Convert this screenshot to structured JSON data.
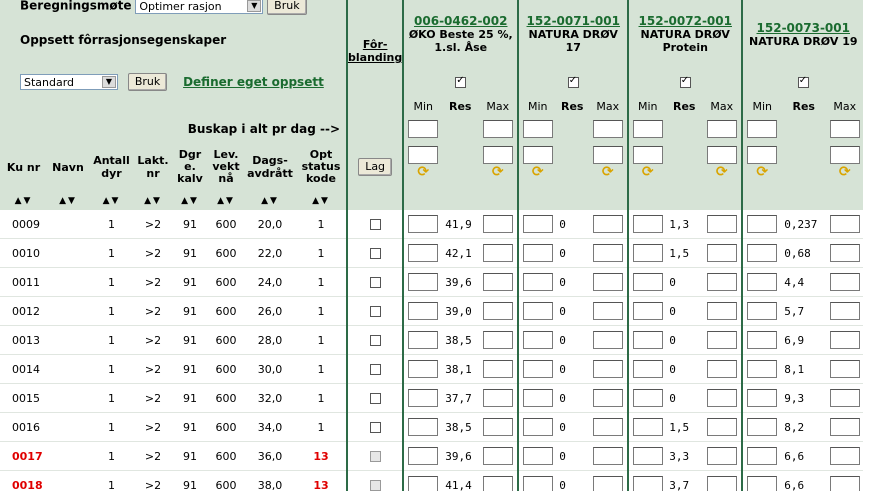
{
  "top": {
    "beregningsmote_label": "Beregningsmøte",
    "beregningsmote_value": "Optimer rasjon",
    "bruk_label": "Bruk",
    "oppsett_title": "Oppsett fôrrasjonsegenskaper",
    "oppsett_value": "Standard",
    "definer_link": "Definer eget oppsett"
  },
  "forblanding_header": "Fôr-blanding",
  "lag_label": "Lag",
  "buskap_label": "Buskap i alt pr dag -->",
  "products": [
    {
      "code": "006-0462-002",
      "name": "ØKO Beste 25 %, 1.sl. Åse",
      "checked": true
    },
    {
      "code": "152-0071-001",
      "name": "NATURA DRØV 17",
      "checked": true
    },
    {
      "code": "152-0072-001",
      "name": "NATURA DRØV Protein",
      "checked": true
    },
    {
      "code": "152-0073-001",
      "name": "NATURA DRØV 19",
      "checked": true
    }
  ],
  "subcols": {
    "min": "Min",
    "res": "Res",
    "max": "Max"
  },
  "columns": {
    "kunr": "Ku nr",
    "navn": "Navn",
    "antall": "Antall dyr",
    "lakt": "Lakt. nr",
    "dgr": "Dgr e. kalv",
    "lev": "Lev. vekt nå",
    "dags": "Dags-avdrått",
    "opt": "Opt status kode"
  },
  "sort_glyph": "▲▼",
  "rows": [
    {
      "kunr": "0009",
      "antall": "1",
      "lakt": ">2",
      "dgr": "91",
      "lev": "600",
      "dags": "20,0",
      "opt": "1",
      "red": false,
      "res": [
        "41,9",
        "0",
        "1,3",
        "0,237"
      ]
    },
    {
      "kunr": "0010",
      "antall": "1",
      "lakt": ">2",
      "dgr": "91",
      "lev": "600",
      "dags": "22,0",
      "opt": "1",
      "red": false,
      "res": [
        "42,1",
        "0",
        "1,5",
        "0,68"
      ]
    },
    {
      "kunr": "0011",
      "antall": "1",
      "lakt": ">2",
      "dgr": "91",
      "lev": "600",
      "dags": "24,0",
      "opt": "1",
      "red": false,
      "res": [
        "39,6",
        "0",
        "0",
        "4,4"
      ]
    },
    {
      "kunr": "0012",
      "antall": "1",
      "lakt": ">2",
      "dgr": "91",
      "lev": "600",
      "dags": "26,0",
      "opt": "1",
      "red": false,
      "res": [
        "39,0",
        "0",
        "0",
        "5,7"
      ]
    },
    {
      "kunr": "0013",
      "antall": "1",
      "lakt": ">2",
      "dgr": "91",
      "lev": "600",
      "dags": "28,0",
      "opt": "1",
      "red": false,
      "res": [
        "38,5",
        "0",
        "0",
        "6,9"
      ]
    },
    {
      "kunr": "0014",
      "antall": "1",
      "lakt": ">2",
      "dgr": "91",
      "lev": "600",
      "dags": "30,0",
      "opt": "1",
      "red": false,
      "res": [
        "38,1",
        "0",
        "0",
        "8,1"
      ]
    },
    {
      "kunr": "0015",
      "antall": "1",
      "lakt": ">2",
      "dgr": "91",
      "lev": "600",
      "dags": "32,0",
      "opt": "1",
      "red": false,
      "res": [
        "37,7",
        "0",
        "0",
        "9,3"
      ]
    },
    {
      "kunr": "0016",
      "antall": "1",
      "lakt": ">2",
      "dgr": "91",
      "lev": "600",
      "dags": "34,0",
      "opt": "1",
      "red": false,
      "res": [
        "38,5",
        "0",
        "1,5",
        "8,2"
      ]
    },
    {
      "kunr": "0017",
      "antall": "1",
      "lakt": ">2",
      "dgr": "91",
      "lev": "600",
      "dags": "36,0",
      "opt": "13",
      "red": true,
      "res": [
        "39,6",
        "0",
        "3,3",
        "6,6"
      ]
    },
    {
      "kunr": "0018",
      "antall": "1",
      "lakt": ">2",
      "dgr": "91",
      "lev": "600",
      "dags": "38,0",
      "opt": "13",
      "red": true,
      "res": [
        "41,4",
        "0",
        "3,7",
        "6,6"
      ]
    }
  ],
  "colors": {
    "header_bg": "#d6e3d6",
    "divider": "#2d6b47",
    "link": "#1a6b2f",
    "alert": "#e00000"
  }
}
